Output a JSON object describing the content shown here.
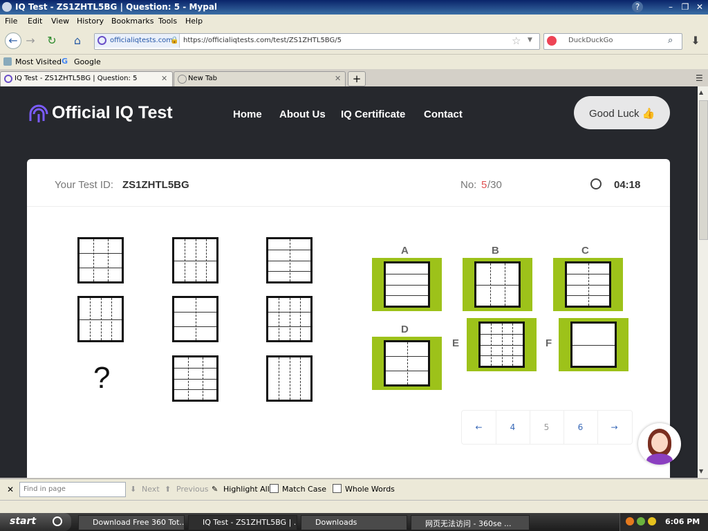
{
  "window": {
    "title": "IQ Test - ZS1ZHTL5BG | Question: 5 - Mypal"
  },
  "menu": [
    "File",
    "Edit",
    "View",
    "History",
    "Bookmarks",
    "Tools",
    "Help"
  ],
  "urlbar": {
    "site": "officialiqtests.com",
    "url": "https://officialiqtests.com/test/ZS1ZHTL5BG/5"
  },
  "search": {
    "placeholder": "DuckDuckGo"
  },
  "bookmarks": [
    "Most Visited",
    "Google"
  ],
  "tabs": [
    {
      "label": "IQ Test - ZS1ZHTL5BG | Question: 5"
    },
    {
      "label": "New Tab"
    }
  ],
  "site": {
    "logo": "Official IQ Test",
    "nav": [
      "Home",
      "About Us",
      "IQ Certificate",
      "Contact"
    ],
    "cta": "Good Luck 👍"
  },
  "test": {
    "id_label": "Your Test ID:",
    "id": "ZS1ZHTL5BG",
    "no_label": "No:",
    "current": "5",
    "total": "/30",
    "timer": "04:18"
  },
  "matrix": [
    {
      "h": 2,
      "v": 2
    },
    {
      "h": 1,
      "v": 3
    },
    {
      "h": 3,
      "v": 1
    },
    {
      "h": 1,
      "v": 3
    },
    {
      "h": 2,
      "v": 1
    },
    {
      "h": 2,
      "v": 3
    },
    {
      "question": "?"
    },
    {
      "h": 3,
      "v": 2
    },
    {
      "h": 0,
      "v": 3
    }
  ],
  "options": [
    {
      "label": "A",
      "h": 3,
      "v": 0
    },
    {
      "label": "B",
      "h": 1,
      "v": 2
    },
    {
      "label": "C",
      "h": 3,
      "v": 1
    },
    {
      "label": "D",
      "h": 2,
      "v": 1
    },
    {
      "label": "E",
      "h": 3,
      "v": 3
    },
    {
      "label": "F",
      "h": 1,
      "v": 0
    }
  ],
  "pagination": {
    "prev": "←",
    "pages": [
      "4",
      "5",
      "6"
    ],
    "next": "→"
  },
  "findbar": {
    "placeholder": "Find in page",
    "next": "Next",
    "previous": "Previous",
    "highlight": "Highlight All",
    "match_case": "Match Case",
    "whole_words": "Whole Words"
  },
  "taskbar": {
    "start": "start",
    "tasks": [
      "Download Free 360 Tot...",
      "IQ Test - ZS1ZHTL5BG | ...",
      "Downloads",
      "网页无法访问 - 360se ..."
    ],
    "clock": "6:06 PM"
  },
  "colors": {
    "accent": "#9dc21a",
    "dark": "#26282d",
    "highlight": "#e05050"
  }
}
